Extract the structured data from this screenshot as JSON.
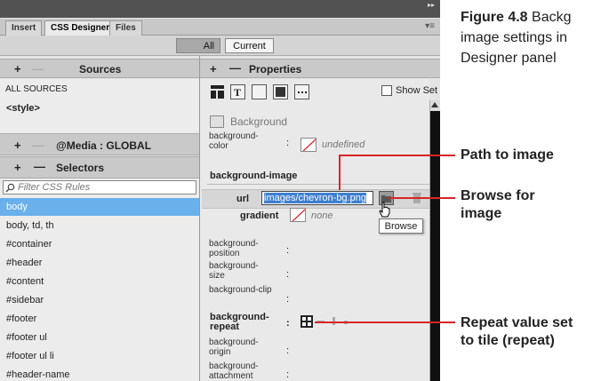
{
  "caption": {
    "figure": "Figure 4.8",
    "line1_rest": "Backg",
    "line2": "image settings in",
    "line3": "Designer panel"
  },
  "tabs": [
    "Insert",
    "CSS Designer",
    "Files"
  ],
  "mode_buttons": {
    "all": "All",
    "current": "Current"
  },
  "sources": {
    "header": "Sources",
    "items": [
      "ALL SOURCES",
      "<style>"
    ]
  },
  "media": {
    "header": "@Media : GLOBAL"
  },
  "selectors": {
    "header": "Selectors",
    "filter_placeholder": "Filter CSS Rules",
    "items": [
      "body",
      "body, td, th",
      "#container",
      "#header",
      "#content",
      "#sidebar",
      "#footer",
      "#footer ul",
      "#footer ul li",
      "#header-name"
    ],
    "selected_index": 0
  },
  "properties": {
    "header": "Properties",
    "show_set": "Show Set",
    "section_background": "Background",
    "bg_color_label_1": "background-",
    "bg_color_label_2": "color",
    "colon": ":",
    "bg_color_value": "undefined",
    "section_bg_image": "background-image",
    "url_label": "url",
    "url_value": "images/chevron-bg.png",
    "gradient_label": "gradient",
    "gradient_value": "none",
    "browse_tooltip": "Browse",
    "pos_1": "background-",
    "pos_2": "position",
    "size_1": "background-",
    "size_2": "size",
    "clip": "background-clip",
    "repeat_1": "background-",
    "repeat_2": "repeat",
    "origin_1": "background-",
    "origin_2": "origin",
    "attach_1": "background-",
    "attach_2": "attachment"
  },
  "annotations": {
    "path": "Path to image",
    "browse_1": "Browse for",
    "browse_2": "image",
    "repeat_1": "Repeat value set",
    "repeat_2": "to tile (repeat)"
  },
  "colors": {
    "accent_red": "#d9252a",
    "selected_row": "#6ab0ea",
    "url_highlight": "#3f7fd0"
  }
}
